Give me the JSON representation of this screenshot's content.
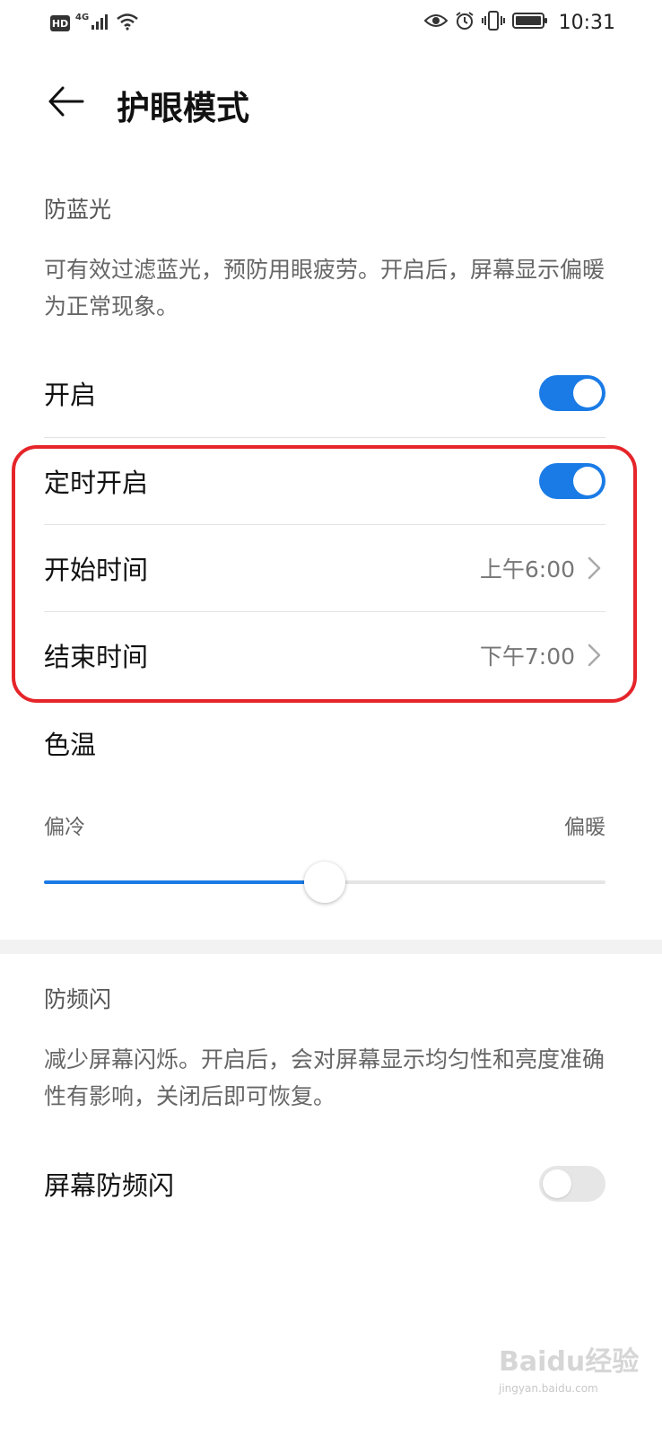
{
  "status_bar": {
    "hd_label": "HD",
    "network_label": "4G",
    "time": "10:31"
  },
  "header": {
    "title": "护眼模式"
  },
  "blue_light": {
    "section_title": "防蓝光",
    "description": "可有效过滤蓝光，预防用眼疲劳。开启后，屏幕显示偏暖为正常现象。",
    "enable_label": "开启",
    "enable_on": true,
    "scheduled_label": "定时开启",
    "scheduled_on": true,
    "start_label": "开始时间",
    "start_value": "上午6:00",
    "end_label": "结束时间",
    "end_value": "下午7:00"
  },
  "color_temp": {
    "title": "色温",
    "min_label": "偏冷",
    "max_label": "偏暖",
    "level": 0.5
  },
  "flicker": {
    "section_title": "防频闪",
    "description": "减少屏幕闪烁。开启后，会对屏幕显示均匀性和亮度准确性有影响，关闭后即可恢复。",
    "toggle_label": "屏幕防频闪",
    "toggle_on": false
  },
  "watermark": {
    "text": "Baidu经验",
    "sub": "jingyan.baidu.com"
  },
  "colors": {
    "accent": "#1a7be6",
    "highlight": "#e5252a"
  }
}
